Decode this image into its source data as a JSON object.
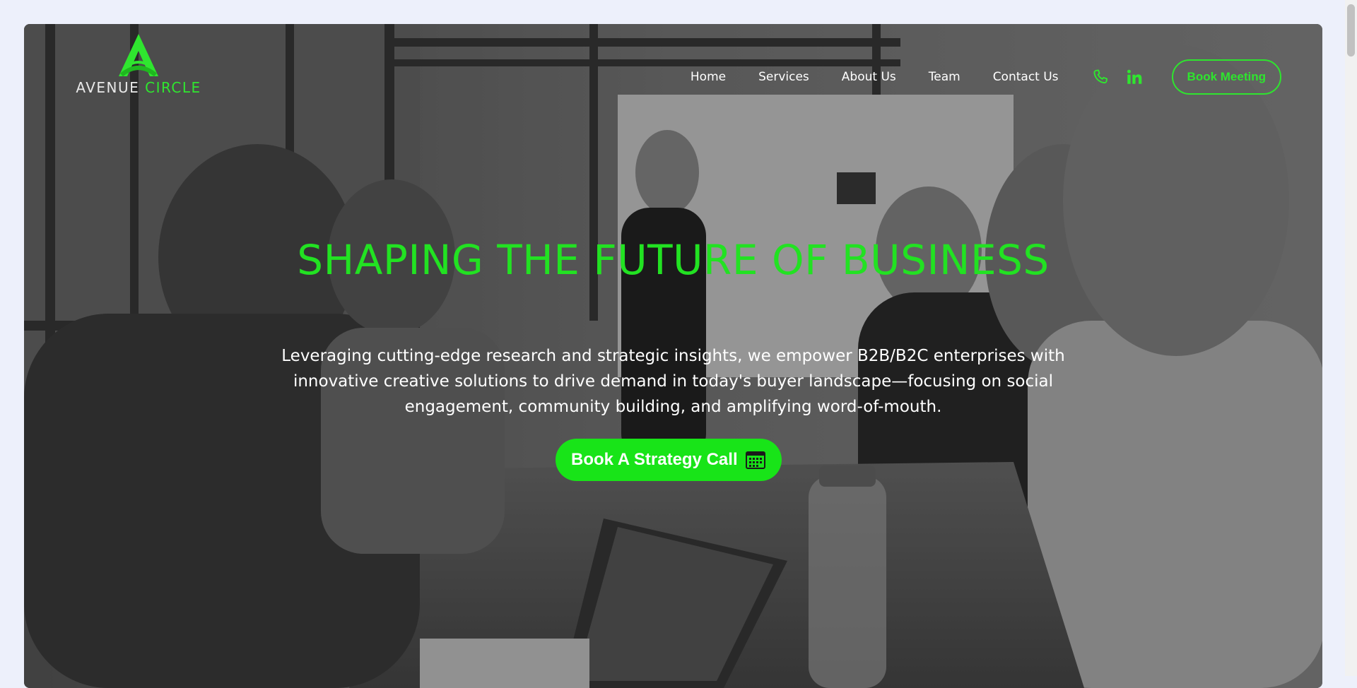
{
  "brand": {
    "word1": "AVENUE",
    "word2": "CIRCLE",
    "accent_color": "#22e222"
  },
  "nav": {
    "links": [
      {
        "label": "Home"
      },
      {
        "label": "Services"
      },
      {
        "label": "About Us"
      },
      {
        "label": "Team"
      },
      {
        "label": "Contact Us"
      }
    ],
    "icons": [
      "phone-icon",
      "linkedin-icon"
    ],
    "book_button": "Book Meeting"
  },
  "hero": {
    "headline": "SHAPING THE FUTURE OF BUSINESS",
    "subtext": "Leveraging cutting-edge research and strategic insights, we empower B2B/B2C enterprises with innovative creative solutions to drive demand in today's buyer landscape—focusing on social engagement, community building, and amplifying word-of-mouth.",
    "cta_label": "Book A Strategy Call",
    "cta_icon": "calendar-icon",
    "background": "grayscale photo of team meeting around a table"
  }
}
